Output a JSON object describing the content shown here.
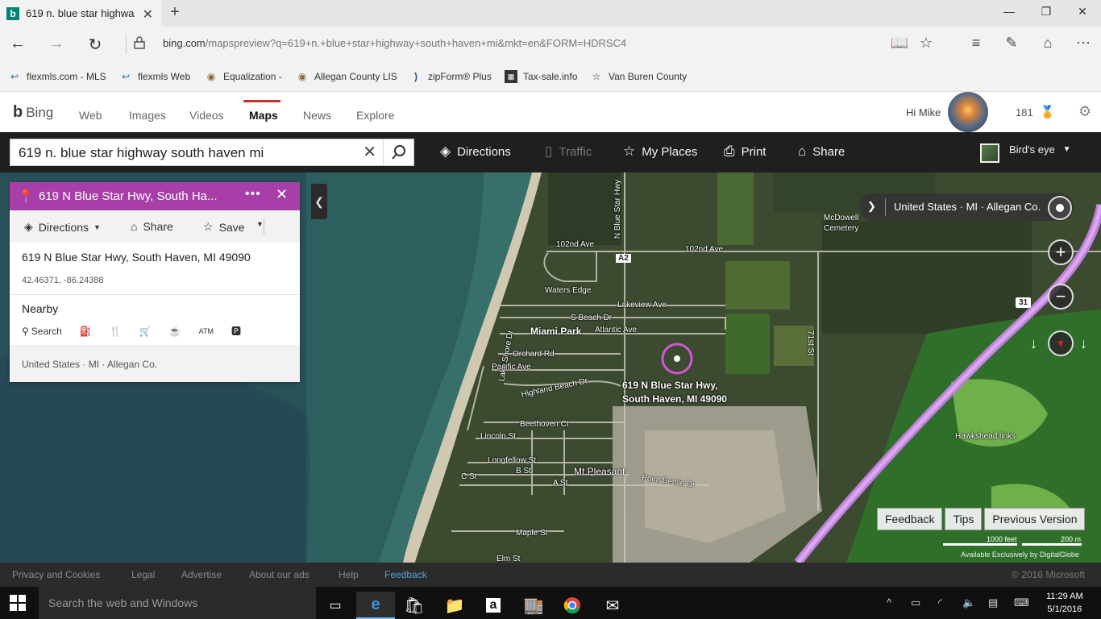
{
  "browser": {
    "tab_title": "619 n. blue star highwa",
    "url_domain": "bing.com",
    "url_rest": "/mapspreview?q=619+n.+blue+star+highway+south+haven+mi&mkt=en&FORM=HDRSC4",
    "favorites": [
      "flexmls.com - MLS",
      "flexmls Web",
      "Equalization -",
      "Allegan County LIS",
      "zipForm® Plus",
      "Tax-sale.info",
      "Van Buren County"
    ]
  },
  "bing": {
    "logo": "Bing",
    "nav": [
      "Web",
      "Images",
      "Videos",
      "Maps",
      "News",
      "Explore"
    ],
    "greeting": "Hi Mike",
    "rewards": "181"
  },
  "toolbar": {
    "search_value": "619 n. blue star highway south haven mi",
    "directions": "Directions",
    "traffic": "Traffic",
    "my_places": "My Places",
    "print": "Print",
    "share": "Share",
    "view_mode": "Bird's eye"
  },
  "card": {
    "title": "619 N Blue Star Hwy, South Ha...",
    "more": "•••",
    "directions": "Directions",
    "share": "Share",
    "save": "Save",
    "address": "619 N Blue Star Hwy, South Haven, MI 49090",
    "coords": "42.46371, -86.24388",
    "nearby": "Nearby",
    "search": "Search",
    "atm": "ATM",
    "region": "United States · MI · Allegan Co."
  },
  "map": {
    "breadcrumb": "United States · MI · Allegan Co.",
    "labels": {
      "cemetery": "McDowell Cemetery",
      "ave_102_w": "102nd Ave",
      "ave_102_e": "102nd Ave",
      "blue_star": "N Blue Star Hwy",
      "a2": "A2",
      "waters_edge": "Waters Edge",
      "lakeview": "Lakeview Ave",
      "beach_dr": "S Beach Dr",
      "miami_park": "Miami Park",
      "atlantic": "Atlantic Ave",
      "orchard": "Orchard Rd",
      "pacific": "Pacific Ave",
      "highland": "Highland Beach Dr",
      "lake_shore": "Lake Shore Dr",
      "beethoven": "Beethoven Ct",
      "lincoln": "Lincoln St",
      "longfellow": "Longfellow St",
      "b_st": "B St",
      "c_st": "C St",
      "a_st": "A St",
      "mt_pleasant": "Mt.Pleasant",
      "point_betsie": "Point Betsie Dr",
      "maple": "Maple St",
      "elm": "Elm St",
      "hawkshead": "Hawkshead links",
      "hwy31": "31",
      "st_71": "71st St",
      "addr_1": "619 N Blue Star Hwy,",
      "addr_2": "South Haven, MI 49090"
    },
    "buttons": [
      "Feedback",
      "Tips",
      "Previous Version"
    ],
    "scale_1": "1000 feet",
    "scale_2": "200 m",
    "attribution": "Available Exclusively by DigitalGlobe"
  },
  "footer": {
    "links": [
      "Privacy and Cookies",
      "Legal",
      "Advertise",
      "About our ads",
      "Help",
      "Feedback"
    ],
    "copyright": "© 2016 Microsoft"
  },
  "taskbar": {
    "search_placeholder": "Search the web and Windows",
    "time": "11:29 AM",
    "date": "5/1/2016"
  },
  "colors": {
    "accent_purple": "#a83ea8",
    "highway": "#c890e6",
    "active_nav": "#c9302c",
    "footer_link": "#4aa3df"
  },
  "icons": [
    "bing-favicon",
    "back-arrow",
    "forward-arrow",
    "refresh",
    "lock",
    "reading-view",
    "star",
    "hub",
    "web-note",
    "share",
    "more",
    "search",
    "directions",
    "traffic",
    "star",
    "printer",
    "share",
    "pin",
    "close",
    "gas",
    "restaurant",
    "shopping",
    "coffee",
    "parking",
    "windows",
    "task-view",
    "edge",
    "store",
    "file-explorer",
    "amazon",
    "chrome",
    "mail"
  ]
}
